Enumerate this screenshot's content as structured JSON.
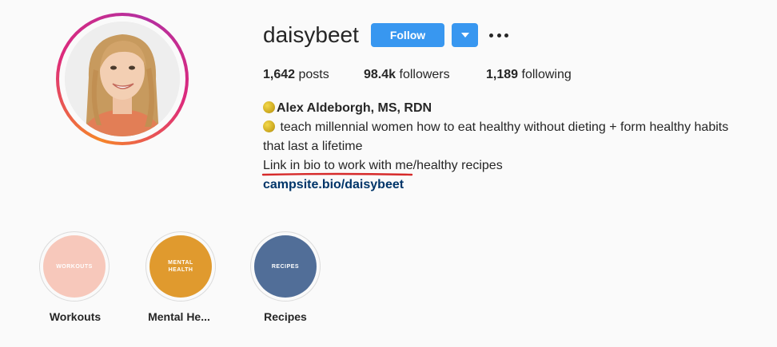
{
  "profile": {
    "username": "daisybeet",
    "follow_label": "Follow"
  },
  "stats": {
    "posts_value": "1,642",
    "posts_label": "posts",
    "followers_value": "98.4k",
    "followers_label": "followers",
    "following_value": "1,189",
    "following_label": "following"
  },
  "bio": {
    "name": "Alex Aldeborgh, MS, RDN",
    "line1": "teach millennial women how to eat healthy without dieting + form healthy habits",
    "line2": "that last a lifetime",
    "line3": "Link in bio to work with me/healthy recipes",
    "link": "campsite.bio/daisybeet",
    "emoji_icon": "lemon-icon"
  },
  "highlights": [
    {
      "cover_text": "WORKOUTS",
      "caption": "Workouts",
      "color": "#f7c8bb"
    },
    {
      "cover_text": "MENTAL\nHEALTH",
      "caption": "Mental He...",
      "color": "#e09a2e"
    },
    {
      "cover_text": "RECIPES",
      "caption": "Recipes",
      "color": "#516e98"
    }
  ],
  "colors": {
    "accent": "#3897f0",
    "link": "#003569",
    "annotation_underline": "#d62a2a",
    "story_ring": [
      "#f58529",
      "#dd2a7b"
    ]
  }
}
